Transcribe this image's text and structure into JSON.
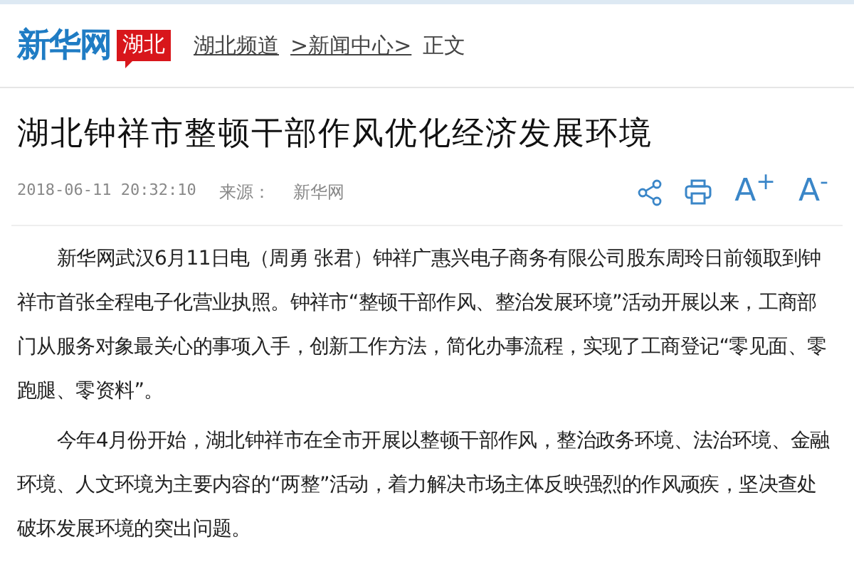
{
  "header": {
    "logo": "新华网",
    "region_badge": "湖北",
    "breadcrumb": [
      "湖北频道",
      ">新闻中心>",
      "正文"
    ]
  },
  "article": {
    "title": "湖北钟祥市整顿干部作风优化经济发展环境",
    "datetime": "2018-06-11 20:32:10",
    "source_label": "来源：",
    "source": "新华网",
    "tools": [
      {
        "kind": "share"
      },
      {
        "kind": "print"
      },
      {
        "kind": "text",
        "label": "A$^{+}$"
      },
      {
        "kind": "text",
        "label": "A$^{-}$"
      }
    ],
    "paragraphs": [
      "新华网武汉6月11日电（周勇 张君）钟祥广惠兴电子商务有限公司股东周玲日前领取到钟祥市首张全程电子化营业执照。钟祥市“整顿干部作风、整治发展环境”活动开展以来，工商部门从服务对象最关心的事项入手，创新工作方法，简化办事流程，实现了工商登记“零见面、零跑腿、零资料”。",
      "今年4月份开始，湖北钟祥市在全市开展以整顿干部作风，整治政务环境、法治环境、金融环境、人文环境为主要内容的“两整”活动，着力解决市场主体反映强烈的作风顽疾，坚决查处破坏发展环境的突出问题。"
    ]
  }
}
